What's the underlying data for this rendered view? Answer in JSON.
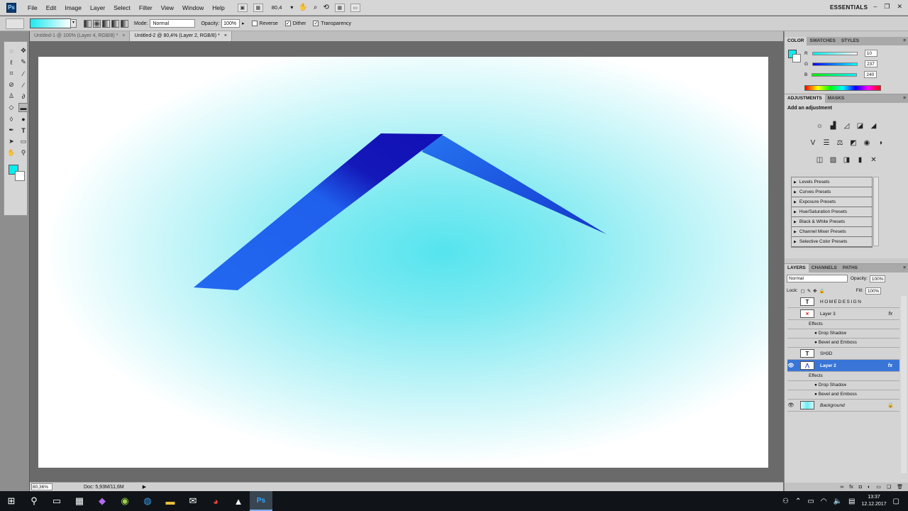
{
  "app": {
    "logo": "Ps"
  },
  "menu": [
    "File",
    "Edit",
    "Image",
    "Layer",
    "Select",
    "Filter",
    "View",
    "Window",
    "Help"
  ],
  "menu_zoom": "80,4",
  "workspace": "ESSENTIALS",
  "options": {
    "mode_label": "Mode:",
    "mode_value": "Normal",
    "opacity_label": "Opacity:",
    "opacity_value": "100%",
    "reverse_label": "Reverse",
    "dither_label": "Dither",
    "transparency_label": "Transparency",
    "reverse_checked": false,
    "dither_checked": true,
    "transparency_checked": true,
    "gradient_colors": [
      "#1ee9ef",
      "#ffffff"
    ]
  },
  "tabs": [
    {
      "label": "Untitled-1 @ 100% (Layer 4, RGB/8) *",
      "close": "×"
    },
    {
      "label": "Untitled-2 @ 80,4% (Layer 2, RGB/8) *",
      "close": "×"
    }
  ],
  "status": {
    "zoom": "80,36%",
    "doc": "Doc: 5,93M/11,6M",
    "arrow": "▶"
  },
  "colors": {
    "foreground": "#0aedf0",
    "background": "#ffffff",
    "shape_dark": "#1512b8",
    "shape_light": "#2165ee"
  },
  "color_panel": {
    "tabs": [
      "COLOR",
      "SWATCHES",
      "STYLES"
    ],
    "r_label": "R",
    "g_label": "G",
    "b_label": "B",
    "r": "10",
    "g": "237",
    "b": "240"
  },
  "adjustments": {
    "tabs": [
      "ADJUSTMENTS",
      "MASKS"
    ],
    "title": "Add an adjustment",
    "presets": [
      "Levels Presets",
      "Curves Presets",
      "Exposure Presets",
      "Hue/Saturation Presets",
      "Black & White Presets",
      "Channel Mixer Presets",
      "Selective Color Presets"
    ]
  },
  "layers": {
    "tabs": [
      "LAYERS",
      "CHANNELS",
      "PATHS"
    ],
    "blend": "Normal",
    "opacity_label": "Opacity:",
    "opacity": "100%",
    "lock_label": "Lock:",
    "fill_label": "Fill:",
    "fill": "100%",
    "items": [
      {
        "name": "HOMEDESIGN",
        "type": "text",
        "thumb": "T",
        "visible": false
      },
      {
        "name": "Layer 3",
        "type": "layer",
        "thumb": "",
        "visible": false,
        "fx": "fx",
        "effects_label": "Effects",
        "effects": [
          "Drop Shadow",
          "Bevel and Emboss"
        ]
      },
      {
        "name": "SH3D",
        "type": "text",
        "thumb": "T",
        "visible": false
      },
      {
        "name": "Layer 2",
        "type": "layer",
        "thumb": "",
        "visible": true,
        "selected": true,
        "fx": "fx",
        "effects_label": "Effects",
        "effects": [
          "Drop Shadow",
          "Bevel and Emboss"
        ]
      },
      {
        "name": "Background",
        "type": "background",
        "thumb": "",
        "visible": true,
        "lock": "🔒"
      }
    ]
  },
  "taskbar": {
    "time": "13:37",
    "date": "12.12.2017",
    "icons": [
      "windows-start-icon",
      "search-icon",
      "task-view-icon",
      "calculator-icon",
      "maps-icon",
      "app-icon",
      "browser-icon",
      "file-explorer-icon",
      "mail-icon",
      "chrome-icon",
      "photos-icon",
      "photoshop-icon"
    ]
  }
}
